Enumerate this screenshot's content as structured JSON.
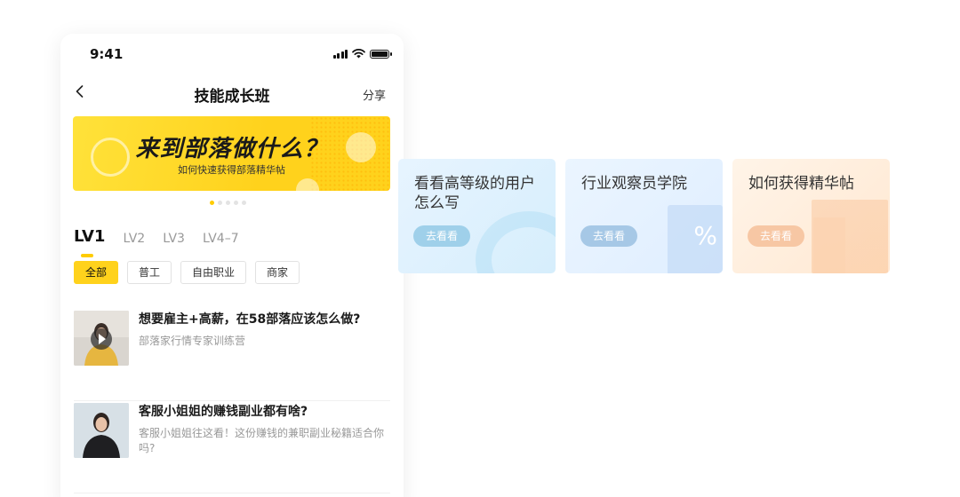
{
  "status": {
    "time": "9:41"
  },
  "nav": {
    "title": "技能成长班",
    "share": "分享"
  },
  "banner": {
    "title": "来到部落做什么？",
    "subtitle": "如何快速获得部落精华帖"
  },
  "levels": [
    "LV1",
    "LV2",
    "LV3",
    "LV4–7"
  ],
  "filters": [
    "全部",
    "普工",
    "自由职业",
    "商家"
  ],
  "list": [
    {
      "title": "想要雇主+高薪，在58部落应该怎么做?",
      "subtitle": "部落家行情专家训练营"
    },
    {
      "title": "客服小姐姐的赚钱副业都有啥?",
      "subtitle": "客服小姐姐往这看！这份赚钱的兼职副业秘籍适合你吗?"
    }
  ],
  "cards": [
    {
      "title": "看看高等级的用户怎么写",
      "button": "去看看",
      "color": "#9fd0ea"
    },
    {
      "title": "行业观察员学院",
      "button": "去看看",
      "color": "#a6c8e6",
      "deco_text": "%"
    },
    {
      "title": "如何获得精华帖",
      "button": "去看看",
      "color": "#f7c7a4"
    }
  ],
  "accent": "#ffd21c"
}
